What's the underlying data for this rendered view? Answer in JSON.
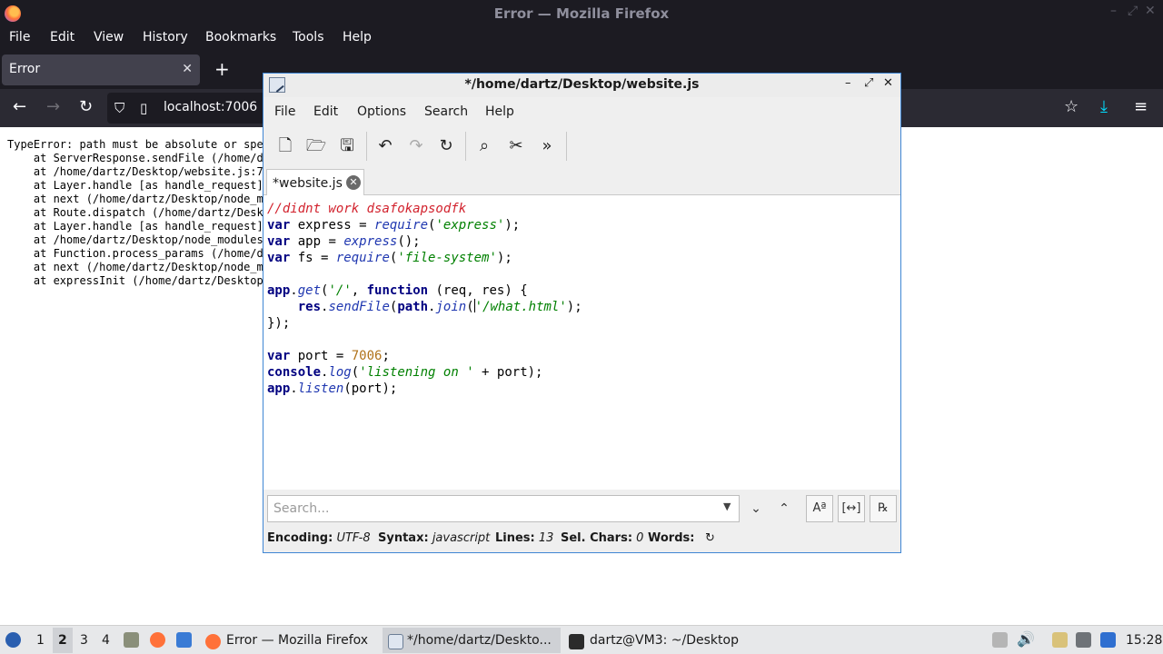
{
  "firefox": {
    "window_title": "Error — Mozilla Firefox",
    "menu": [
      "File",
      "Edit",
      "View",
      "History",
      "Bookmarks",
      "Tools",
      "Help"
    ],
    "tab_title": "Error",
    "url": "localhost:7006",
    "error_lines": [
      "TypeError: path must be absolute or spe",
      "    at ServerResponse.sendFile (/home/d",
      "    at /home/dartz/Desktop/website.js:7",
      "    at Layer.handle [as handle_request]",
      "    at next (/home/dartz/Desktop/node_m",
      "    at Route.dispatch (/home/dartz/Desk",
      "    at Layer.handle [as handle_request]",
      "    at /home/dartz/Desktop/node_modules",
      "    at Function.process_params (/home/d",
      "    at next (/home/dartz/Desktop/node_m",
      "    at expressInit (/home/dartz/Desktop"
    ]
  },
  "editor": {
    "window_title": "*/home/dartz/Desktop/website.js",
    "menu": [
      "File",
      "Edit",
      "Options",
      "Search",
      "Help"
    ],
    "tab_label": "*website.js",
    "search_placeholder": "Search...",
    "code": {
      "l1": "//didnt work dsafokapsodfk",
      "l2_kw": "var",
      "l2_a": " express = ",
      "l2_fn": "require",
      "l2_b": "(",
      "l2_str": "'express'",
      "l2_c": ");",
      "l3_kw": "var",
      "l3_a": " app = ",
      "l3_fn": "express",
      "l3_b": "();",
      "l4_kw": "var",
      "l4_a": " fs = ",
      "l4_fn": "require",
      "l4_b": "(",
      "l4_str": "'file-system'",
      "l4_c": ");",
      "l6_kw": "app",
      "l6_a": ".",
      "l6_fn": "get",
      "l6_b": "(",
      "l6_str": "'/'",
      "l6_c": ", ",
      "l6_kw2": "function",
      "l6_d": " (req, res) {",
      "l7_kw": "res",
      "l7_a": ".",
      "l7_fn": "sendFile",
      "l7_b": "(",
      "l7_kw2": "path",
      "l7_c": ".",
      "l7_fn2": "join",
      "l7_d": "(",
      "l7_str": "'/what.html'",
      "l7_e": ");",
      "l8": "});",
      "l10_kw": "var",
      "l10_a": " port = ",
      "l10_num": "7006",
      "l10_b": ";",
      "l11_kw": "console",
      "l11_a": ".",
      "l11_fn": "log",
      "l11_b": "(",
      "l11_str": "'listening on '",
      "l11_c": " + port);",
      "l12_kw": "app",
      "l12_a": ".",
      "l12_fn": "listen",
      "l12_b": "(port);"
    },
    "status": {
      "encoding_label": "Encoding:",
      "encoding": "UTF-8",
      "syntax_label": "Syntax:",
      "syntax": "javascript",
      "lines_label": "Lines:",
      "lines": "13",
      "sel_label": "Sel. Chars:",
      "sel": "0",
      "words_label": "Words:"
    }
  },
  "taskbar": {
    "workspaces": [
      "1",
      "2",
      "3",
      "4"
    ],
    "tasks": [
      "Error — Mozilla Firefox",
      "*/home/dartz/Deskto...",
      "dartz@VM3: ~/Desktop"
    ],
    "clock": "15:28"
  }
}
